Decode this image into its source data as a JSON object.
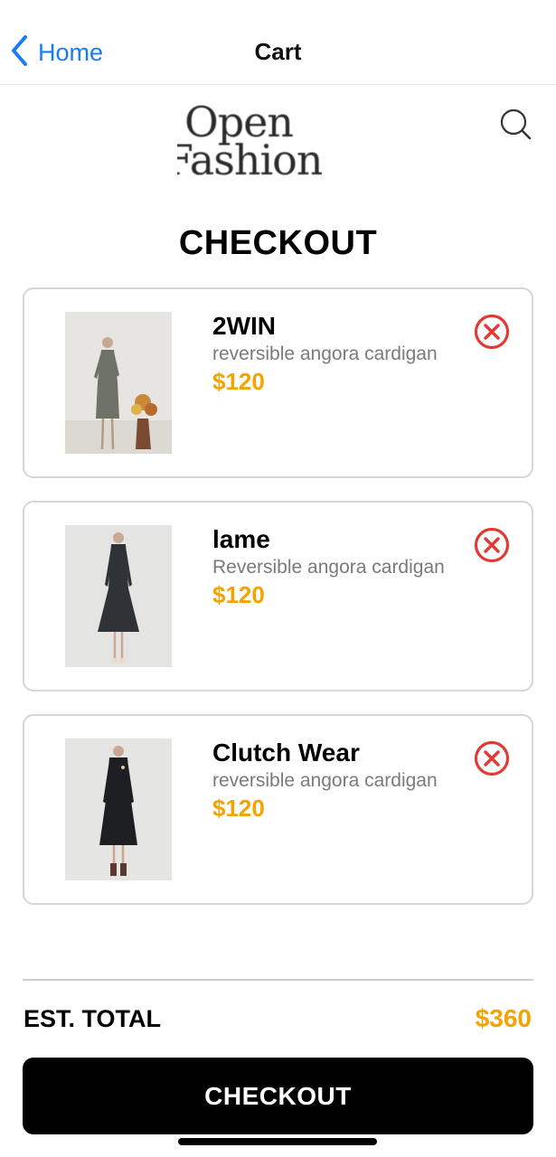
{
  "nav": {
    "back_label": "Home",
    "title": "Cart"
  },
  "logo": {
    "line1": "Open",
    "line2": "Fashion"
  },
  "heading": "CHECKOUT",
  "items": [
    {
      "brand": "2WIN",
      "description": "reversible angora cardigan",
      "price": "$120",
      "outfit_color": "#6f7266"
    },
    {
      "brand": "lame",
      "description": "Reversible angora cardigan",
      "price": "$120",
      "outfit_color": "#2f3338"
    },
    {
      "brand": "Clutch Wear",
      "description": "reversible angora cardigan",
      "price": "$120",
      "outfit_color": "#1e1f22"
    }
  ],
  "total": {
    "label": "EST. TOTAL",
    "value": "$360"
  },
  "checkout_button": "CHECKOUT",
  "colors": {
    "accent_link": "#1a7cf2",
    "price": "#f4a300",
    "remove": "#e53935",
    "button_bg": "#000000"
  },
  "icons": {
    "back": "chevron-left-icon",
    "search": "search-icon",
    "remove": "remove-circle-x-icon"
  }
}
